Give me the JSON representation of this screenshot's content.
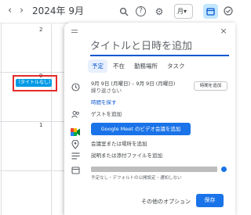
{
  "header": {
    "prev_symbol": "‹",
    "next_symbol": "›",
    "month_title": "2024年 9月",
    "search_icon": "search-icon",
    "help_icon": "help-icon",
    "help_symbol": "?",
    "settings_icon": "gear-icon",
    "settings_symbol": "⚙",
    "view_value": "月",
    "view_chevron": "▾"
  },
  "calendar": {
    "day_numbers": [
      "2",
      "9",
      "1"
    ],
    "event_chip_label": "（タイトルなし）",
    "accent_color": "#039be5",
    "highlight_color": "#e52b2b"
  },
  "dialog": {
    "close_symbol": "×",
    "title_placeholder": "タイトルと日時を追加",
    "tabs": [
      {
        "label": "予定",
        "active": true
      },
      {
        "label": "不在",
        "active": false
      },
      {
        "label": "勤務場所",
        "active": false
      },
      {
        "label": "タスク",
        "active": false
      }
    ],
    "date_range": "9月 9日 (月曜日)  –  9月 9日 (月曜日)",
    "repeat_text": "繰り返さない",
    "add_time_button": "時間を追加",
    "find_time_link": "時間を探す",
    "add_guests": "ゲストを追加",
    "meet_button": "Google Meet のビデオ会議を追加",
    "add_location": "会議室または場所を追加",
    "add_description": "説明または添付ファイルを追加",
    "visibility_text": "予定なし・デフォルトの公開設定・通知しない",
    "more_options": "その他のオプション",
    "save_button": "保存",
    "primary_color": "#1a73e8"
  }
}
